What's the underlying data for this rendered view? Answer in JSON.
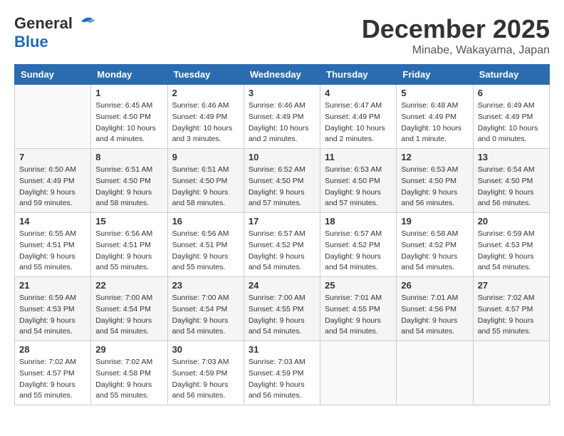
{
  "header": {
    "logo_general": "General",
    "logo_blue": "Blue",
    "month": "December 2025",
    "location": "Minabe, Wakayama, Japan"
  },
  "weekdays": [
    "Sunday",
    "Monday",
    "Tuesday",
    "Wednesday",
    "Thursday",
    "Friday",
    "Saturday"
  ],
  "weeks": [
    [
      {
        "day": "",
        "info": ""
      },
      {
        "day": "1",
        "info": "Sunrise: 6:45 AM\nSunset: 4:50 PM\nDaylight: 10 hours\nand 4 minutes."
      },
      {
        "day": "2",
        "info": "Sunrise: 6:46 AM\nSunset: 4:49 PM\nDaylight: 10 hours\nand 3 minutes."
      },
      {
        "day": "3",
        "info": "Sunrise: 6:46 AM\nSunset: 4:49 PM\nDaylight: 10 hours\nand 2 minutes."
      },
      {
        "day": "4",
        "info": "Sunrise: 6:47 AM\nSunset: 4:49 PM\nDaylight: 10 hours\nand 2 minutes."
      },
      {
        "day": "5",
        "info": "Sunrise: 6:48 AM\nSunset: 4:49 PM\nDaylight: 10 hours\nand 1 minute."
      },
      {
        "day": "6",
        "info": "Sunrise: 6:49 AM\nSunset: 4:49 PM\nDaylight: 10 hours\nand 0 minutes."
      }
    ],
    [
      {
        "day": "7",
        "info": "Sunrise: 6:50 AM\nSunset: 4:49 PM\nDaylight: 9 hours\nand 59 minutes."
      },
      {
        "day": "8",
        "info": "Sunrise: 6:51 AM\nSunset: 4:50 PM\nDaylight: 9 hours\nand 58 minutes."
      },
      {
        "day": "9",
        "info": "Sunrise: 6:51 AM\nSunset: 4:50 PM\nDaylight: 9 hours\nand 58 minutes."
      },
      {
        "day": "10",
        "info": "Sunrise: 6:52 AM\nSunset: 4:50 PM\nDaylight: 9 hours\nand 57 minutes."
      },
      {
        "day": "11",
        "info": "Sunrise: 6:53 AM\nSunset: 4:50 PM\nDaylight: 9 hours\nand 57 minutes."
      },
      {
        "day": "12",
        "info": "Sunrise: 6:53 AM\nSunset: 4:50 PM\nDaylight: 9 hours\nand 56 minutes."
      },
      {
        "day": "13",
        "info": "Sunrise: 6:54 AM\nSunset: 4:50 PM\nDaylight: 9 hours\nand 56 minutes."
      }
    ],
    [
      {
        "day": "14",
        "info": "Sunrise: 6:55 AM\nSunset: 4:51 PM\nDaylight: 9 hours\nand 55 minutes."
      },
      {
        "day": "15",
        "info": "Sunrise: 6:56 AM\nSunset: 4:51 PM\nDaylight: 9 hours\nand 55 minutes."
      },
      {
        "day": "16",
        "info": "Sunrise: 6:56 AM\nSunset: 4:51 PM\nDaylight: 9 hours\nand 55 minutes."
      },
      {
        "day": "17",
        "info": "Sunrise: 6:57 AM\nSunset: 4:52 PM\nDaylight: 9 hours\nand 54 minutes."
      },
      {
        "day": "18",
        "info": "Sunrise: 6:57 AM\nSunset: 4:52 PM\nDaylight: 9 hours\nand 54 minutes."
      },
      {
        "day": "19",
        "info": "Sunrise: 6:58 AM\nSunset: 4:52 PM\nDaylight: 9 hours\nand 54 minutes."
      },
      {
        "day": "20",
        "info": "Sunrise: 6:59 AM\nSunset: 4:53 PM\nDaylight: 9 hours\nand 54 minutes."
      }
    ],
    [
      {
        "day": "21",
        "info": "Sunrise: 6:59 AM\nSunset: 4:53 PM\nDaylight: 9 hours\nand 54 minutes."
      },
      {
        "day": "22",
        "info": "Sunrise: 7:00 AM\nSunset: 4:54 PM\nDaylight: 9 hours\nand 54 minutes."
      },
      {
        "day": "23",
        "info": "Sunrise: 7:00 AM\nSunset: 4:54 PM\nDaylight: 9 hours\nand 54 minutes."
      },
      {
        "day": "24",
        "info": "Sunrise: 7:00 AM\nSunset: 4:55 PM\nDaylight: 9 hours\nand 54 minutes."
      },
      {
        "day": "25",
        "info": "Sunrise: 7:01 AM\nSunset: 4:55 PM\nDaylight: 9 hours\nand 54 minutes."
      },
      {
        "day": "26",
        "info": "Sunrise: 7:01 AM\nSunset: 4:56 PM\nDaylight: 9 hours\nand 54 minutes."
      },
      {
        "day": "27",
        "info": "Sunrise: 7:02 AM\nSunset: 4:57 PM\nDaylight: 9 hours\nand 55 minutes."
      }
    ],
    [
      {
        "day": "28",
        "info": "Sunrise: 7:02 AM\nSunset: 4:57 PM\nDaylight: 9 hours\nand 55 minutes."
      },
      {
        "day": "29",
        "info": "Sunrise: 7:02 AM\nSunset: 4:58 PM\nDaylight: 9 hours\nand 55 minutes."
      },
      {
        "day": "30",
        "info": "Sunrise: 7:03 AM\nSunset: 4:59 PM\nDaylight: 9 hours\nand 56 minutes."
      },
      {
        "day": "31",
        "info": "Sunrise: 7:03 AM\nSunset: 4:59 PM\nDaylight: 9 hours\nand 56 minutes."
      },
      {
        "day": "",
        "info": ""
      },
      {
        "day": "",
        "info": ""
      },
      {
        "day": "",
        "info": ""
      }
    ]
  ]
}
